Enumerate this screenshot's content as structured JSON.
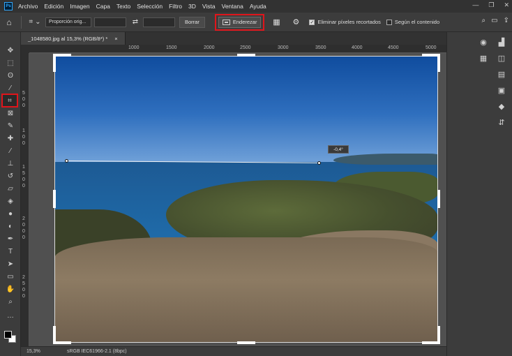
{
  "menubar": {
    "logo": "Ps",
    "items": [
      "Archivo",
      "Edición",
      "Imagen",
      "Capa",
      "Texto",
      "Selección",
      "Filtro",
      "3D",
      "Vista",
      "Ventana",
      "Ayuda"
    ],
    "window_controls": [
      "—",
      "❐",
      "✕"
    ]
  },
  "options": {
    "ratio_select": "Proporción orig...",
    "clear_label": "Borrar",
    "straighten_label": "Enderezar",
    "delete_cropped_label": "Eliminar píxeles recortados",
    "delete_cropped_checked": true,
    "content_aware_label": "Según el contenido",
    "content_aware_checked": false
  },
  "document": {
    "tab_title": "_1048580.jpg al 15,3% (RGB/8*) *",
    "close_label": "×"
  },
  "ruler": {
    "top_ticks": [
      "1000",
      "1500",
      "2000",
      "2500",
      "3000",
      "3500",
      "4000",
      "4500",
      "5000"
    ],
    "left_ticks": [
      "5",
      "0",
      "0",
      "1",
      "0",
      "0",
      "1",
      "5",
      "0",
      "0",
      "2",
      "0",
      "0",
      "0",
      "2",
      "5",
      "0",
      "0"
    ]
  },
  "canvas": {
    "angle_readout": "-0,4°"
  },
  "status": {
    "zoom": "15,3%",
    "profile": "sRGB IEC61966-2.1 (8bpc)"
  },
  "colors": {
    "highlight": "#e0151b",
    "foreground": "#000000",
    "background": "#ffffff"
  }
}
